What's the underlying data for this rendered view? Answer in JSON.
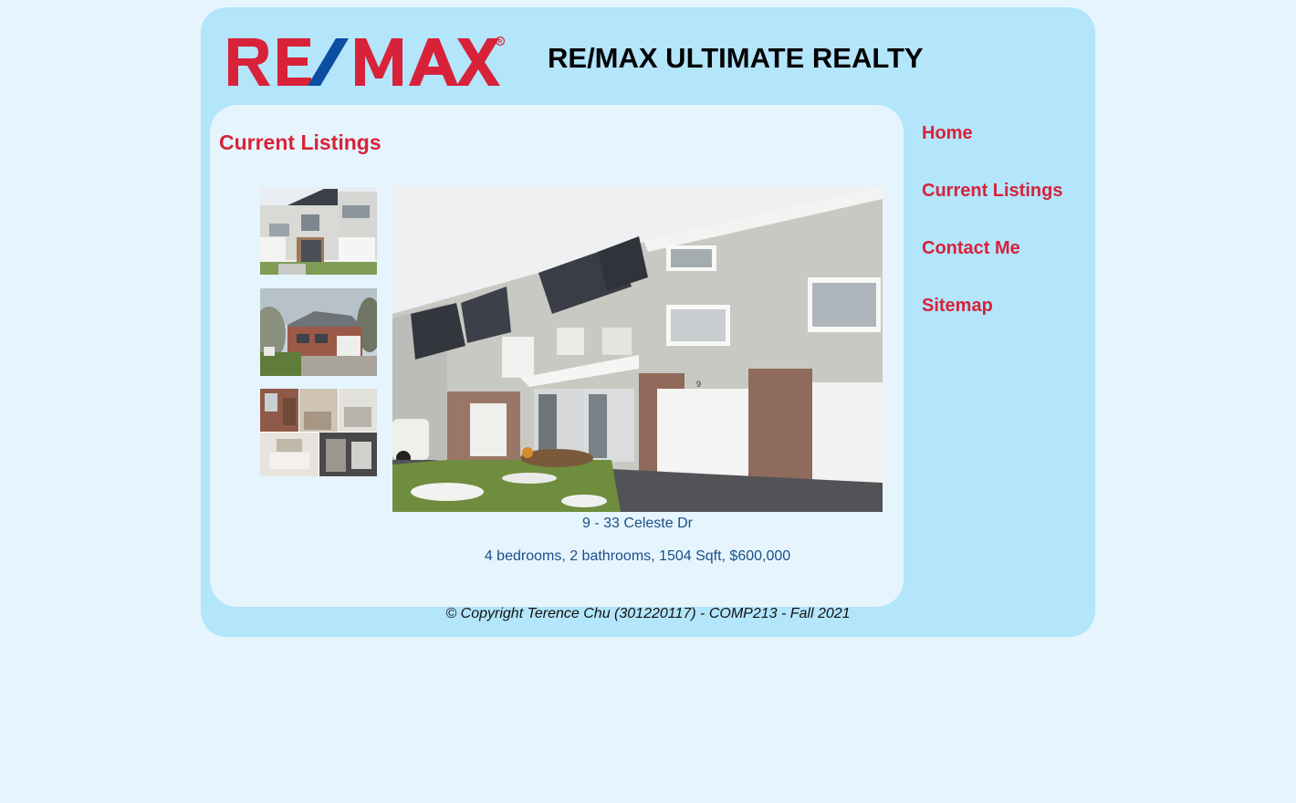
{
  "header": {
    "logo_text": "RE/MAX",
    "site_title": "RE/MAX ULTIMATE REALTY"
  },
  "main": {
    "title": "Current Listings",
    "thumbnails": [
      {
        "alt": "townhouse-thumbnail"
      },
      {
        "alt": "detached-house-thumbnail"
      },
      {
        "alt": "interior-collage-thumbnail"
      }
    ],
    "listing": {
      "address": "9 - 33 Celeste Dr",
      "details": "4 bedrooms, 2 bathrooms, 1504 Sqft, $600,000",
      "unit_number": "9"
    }
  },
  "nav": {
    "items": [
      {
        "label": "Home"
      },
      {
        "label": "Current Listings"
      },
      {
        "label": "Contact Me"
      },
      {
        "label": "Sitemap"
      }
    ]
  },
  "footer": {
    "copyright": "© Copyright Terence Chu (301220117) - COMP213 - Fall 2021"
  },
  "colors": {
    "page_bg": "#e6f5fd",
    "container_bg": "#b3e5fb",
    "accent_red": "#d8223a",
    "logo_blue": "#0b4ea2",
    "text_blue": "#1a4f8a"
  }
}
